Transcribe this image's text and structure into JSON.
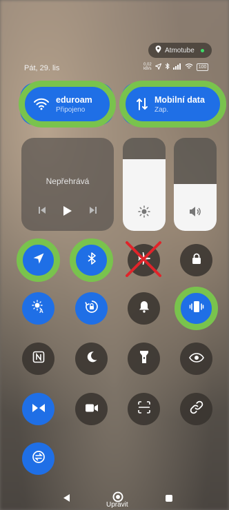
{
  "location_pill": {
    "label": "Atmotube"
  },
  "status_bar": {
    "date": "Pát, 29. lis",
    "speed": "0,02",
    "speed_unit": "kB/s",
    "battery": "100"
  },
  "wifi_tile": {
    "title": "eduroam",
    "subtitle": "Připojeno"
  },
  "mobile_tile": {
    "title": "Mobilní data",
    "subtitle": "Zap."
  },
  "media": {
    "status": "Nepřehrává"
  },
  "nav": {
    "edit_label": "Upravit"
  },
  "colors": {
    "accent": "#1f6fe6",
    "highlight": "#79c34d",
    "cross": "#e0242a"
  }
}
